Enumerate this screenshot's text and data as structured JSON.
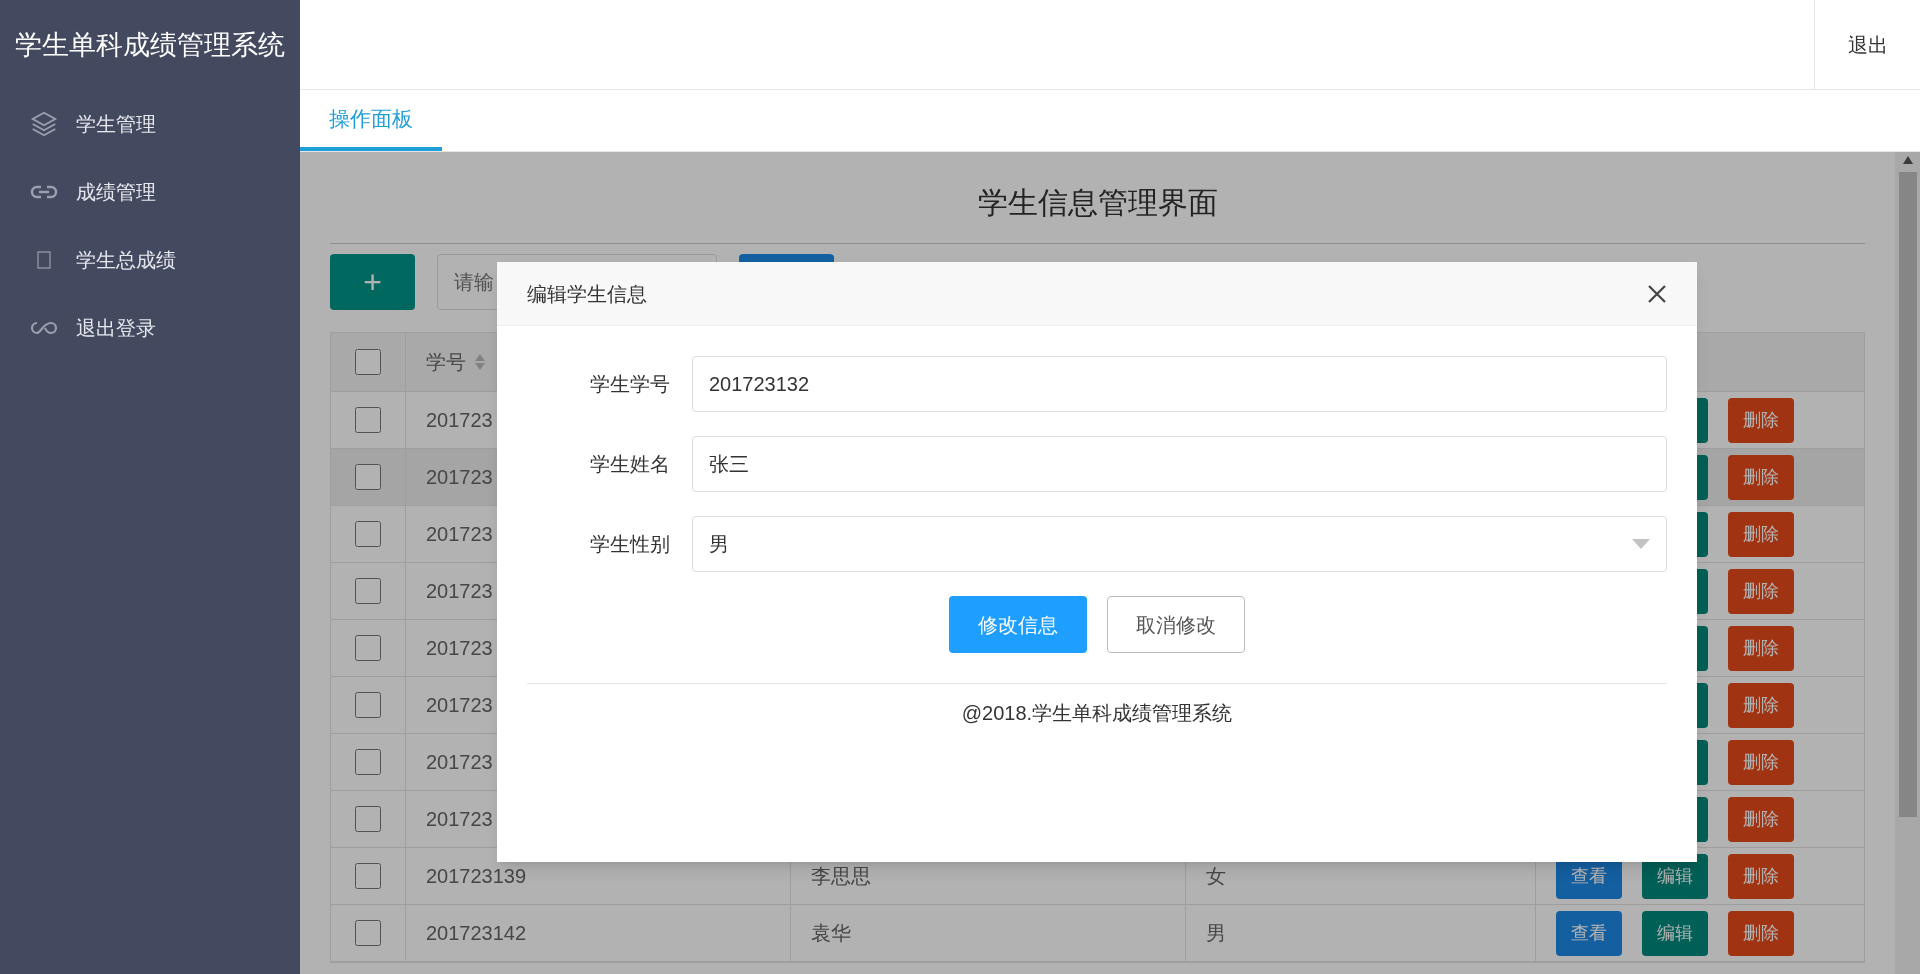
{
  "app_title": "学生单科成绩管理系统",
  "sidebar": {
    "items": [
      {
        "kind": "layers",
        "label": "学生管理"
      },
      {
        "kind": "link",
        "label": "成绩管理"
      },
      {
        "kind": "blank",
        "label": "学生总成绩"
      },
      {
        "kind": "infinity",
        "label": "退出登录"
      }
    ]
  },
  "top_bar": {
    "logout": "退出"
  },
  "tabs": [
    {
      "label": "操作面板",
      "selected": true
    }
  ],
  "panel": {
    "title": "学生信息管理界面",
    "add_button": "+",
    "search": {
      "placeholder": "请输"
    },
    "table": {
      "header_checked": false,
      "columns": [
        {
          "label": "学号",
          "sortable": true
        }
      ],
      "rows": [
        {
          "checked": false,
          "highlighted": false,
          "cells": [
            "201723"
          ],
          "actions": [
            {
              "kind": "edit"
            },
            {
              "kind": "delete",
              "label": "删除"
            }
          ]
        },
        {
          "checked": false,
          "highlighted": true,
          "cells": [
            "201723"
          ],
          "actions": [
            {
              "kind": "edit"
            },
            {
              "kind": "delete",
              "label": "删除"
            }
          ]
        },
        {
          "checked": false,
          "highlighted": false,
          "cells": [
            "201723"
          ],
          "actions": [
            {
              "kind": "edit"
            },
            {
              "kind": "delete",
              "label": "删除"
            }
          ]
        },
        {
          "checked": false,
          "highlighted": false,
          "cells": [
            "201723"
          ],
          "actions": [
            {
              "kind": "edit"
            },
            {
              "kind": "delete",
              "label": "删除"
            }
          ]
        },
        {
          "checked": false,
          "highlighted": false,
          "cells": [
            "201723"
          ],
          "actions": [
            {
              "kind": "edit"
            },
            {
              "kind": "delete",
              "label": "删除"
            }
          ]
        },
        {
          "checked": false,
          "highlighted": false,
          "cells": [
            "201723"
          ],
          "actions": [
            {
              "kind": "edit"
            },
            {
              "kind": "delete",
              "label": "删除"
            }
          ]
        },
        {
          "checked": false,
          "highlighted": false,
          "cells": [
            "201723"
          ],
          "actions": [
            {
              "kind": "edit"
            },
            {
              "kind": "delete",
              "label": "删除"
            }
          ]
        },
        {
          "checked": false,
          "highlighted": false,
          "cells": [
            "201723"
          ],
          "actions": [
            {
              "kind": "edit"
            },
            {
              "kind": "delete",
              "label": "删除"
            }
          ]
        },
        {
          "checked": false,
          "highlighted": false,
          "cells": [
            "201723139",
            "李思思",
            "女"
          ],
          "actions": [
            {
              "kind": "view",
              "label": "查看"
            },
            {
              "kind": "edit",
              "label": "编辑"
            },
            {
              "kind": "delete",
              "label": "删除"
            }
          ]
        },
        {
          "checked": false,
          "highlighted": false,
          "cells": [
            "201723142",
            "袁华",
            "男"
          ],
          "actions": [
            {
              "kind": "view",
              "label": "查看"
            },
            {
              "kind": "edit",
              "label": "编辑"
            },
            {
              "kind": "delete",
              "label": "删除"
            }
          ]
        }
      ]
    }
  },
  "modal": {
    "title": "编辑学生信息",
    "fields": [
      {
        "kind": "input",
        "label": "学生学号",
        "value": "201723132"
      },
      {
        "kind": "input",
        "label": "学生姓名",
        "value": "张三"
      },
      {
        "kind": "select",
        "label": "学生性别",
        "value": "男"
      }
    ],
    "buttons": [
      {
        "kind": "primary",
        "label": "修改信息"
      },
      {
        "kind": "default",
        "label": "取消修改"
      }
    ],
    "footer": "@2018.学生单科成绩管理系统"
  }
}
